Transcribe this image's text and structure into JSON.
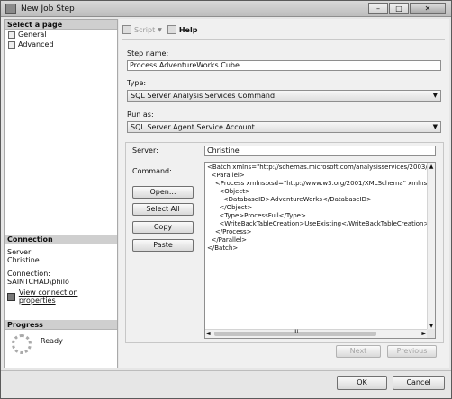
{
  "window": {
    "title": "New Job Step",
    "minimize_glyph": "–",
    "maximize_glyph": "□",
    "close_glyph": "✕"
  },
  "sidebar": {
    "select_page_header": "Select a page",
    "pages": [
      {
        "label": "General",
        "icon": "page-icon"
      },
      {
        "label": "Advanced",
        "icon": "page-icon"
      }
    ],
    "connection_header": "Connection",
    "server_label": "Server:",
    "server_value": "Christine",
    "connection_label": "Connection:",
    "connection_value": "SAINTCHAD\\philo",
    "view_connection_link": "View connection properties",
    "progress_header": "Progress",
    "progress_status": "Ready"
  },
  "toolbar": {
    "script_label": "Script",
    "script_arrow": "▼",
    "help_label": "Help"
  },
  "form": {
    "step_name_label": "Step name:",
    "step_name_value": "Process AdventureWorks Cube",
    "type_label": "Type:",
    "type_value": "SQL Server Analysis Services Command",
    "run_as_label": "Run as:",
    "run_as_value": "SQL Server Agent Service Account",
    "server_label": "Server:",
    "server_value": "Christine",
    "command_label": "Command:",
    "command_text": "<Batch xmlns=\"http://schemas.microsoft.com/analysisservices/2003/en\n  <Parallel>\n    <Process xmlns:xsd=\"http://www.w3.org/2001/XMLSchema\" xmlns:\n      <Object>\n        <DatabaseID>AdventureWorks</DatabaseID>\n      </Object>\n      <Type>ProcessFull</Type>\n      <WriteBackTableCreation>UseExisting</WriteBackTableCreation>\n    </Process>\n  </Parallel>\n</Batch>",
    "hscroll_thumb": "III",
    "open_button": "Open...",
    "select_all_button": "Select All",
    "copy_button": "Copy",
    "paste_button": "Paste",
    "next_button": "Next",
    "previous_button": "Previous"
  },
  "footer": {
    "ok_button": "OK",
    "cancel_button": "Cancel"
  },
  "combo_arrow": "▼",
  "scroll_up": "▲",
  "scroll_down": "▼",
  "scroll_left": "◄",
  "scroll_right": "►"
}
